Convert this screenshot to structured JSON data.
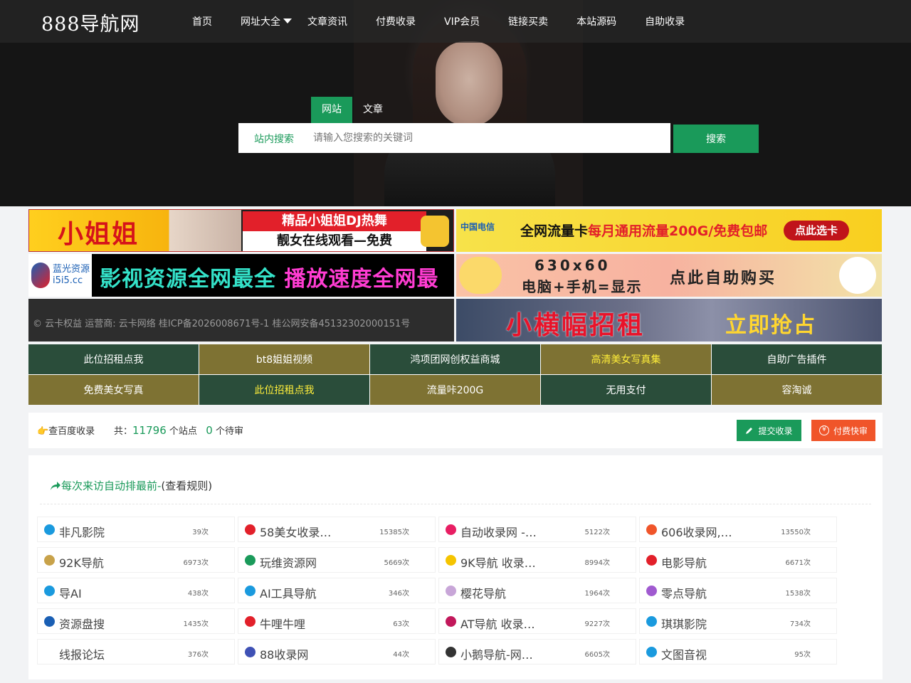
{
  "header": {
    "logo": "888导航网",
    "nav": [
      "首页",
      "网址大全",
      "文章资讯",
      "付费收录",
      "VIP会员",
      "链接买卖",
      "本站源码",
      "自助收录"
    ]
  },
  "search": {
    "tabs": [
      "网站",
      "文章"
    ],
    "label": "站内搜索",
    "placeholder": "请输入您搜索的关键词",
    "button": "搜索"
  },
  "banners": {
    "b1": {
      "big": "小姐姐",
      "line1": "精品小姐姐DJ热舞",
      "line2": "靓女在线观看—免费"
    },
    "b2": {
      "brand": "中国电信",
      "text_a": "全网流量卡",
      "text_b": "每月通用流量200G/免费包邮",
      "button": "点此选卡"
    },
    "b3": {
      "brand_top": "蓝光资源",
      "brand_bottom": "i5i5.cc",
      "text_a": "影视资源全网最全",
      "text_b": "播放速度全网最快"
    },
    "b4": {
      "size": "630x60",
      "line2": "电脑+手机=显示",
      "cta": "点此自助购买"
    },
    "b5": {
      "footer": "© 云卡权益 运营商: 云卡网络 桂ICP备2026008671号-1  桂公网安备45132302000151号"
    },
    "b6": {
      "text_a": "小横幅招租",
      "text_b": "立即抢占"
    }
  },
  "link_grid": [
    {
      "label": "此位招租点我",
      "style": "dg",
      "highlight": false
    },
    {
      "label": "bt8姐姐视频",
      "style": "ol",
      "highlight": false
    },
    {
      "label": "鸿项团网创权益商城",
      "style": "dg",
      "highlight": false
    },
    {
      "label": "高清美女写真集",
      "style": "ol",
      "highlight": true
    },
    {
      "label": "自助广告插件",
      "style": "dg",
      "highlight": false
    },
    {
      "label": "免费美女写真",
      "style": "ol",
      "highlight": false
    },
    {
      "label": "此位招租点我",
      "style": "dg",
      "highlight": true
    },
    {
      "label": "流量咔200G",
      "style": "ol",
      "highlight": false
    },
    {
      "label": "无用支付",
      "style": "dg",
      "highlight": false
    },
    {
      "label": "容淘诚",
      "style": "ol",
      "highlight": false
    }
  ],
  "stats": {
    "baidu": "👉查百度收录",
    "total_prefix": "共：",
    "total": "11796",
    "total_suffix": " 个站点",
    "pending": "0",
    "pending_suffix": " 个待审",
    "submit": "提交收录",
    "paid": "付费快审"
  },
  "panel": {
    "title": "每次来访自动排最前-",
    "rule": "(查看规则)",
    "sites": [
      {
        "name": "非凡影院",
        "count": "39次",
        "icon_color": "#1a9ade"
      },
      {
        "name": "58美女收录…",
        "count": "15385次",
        "icon_color": "#e2202a"
      },
      {
        "name": "自动收录网 -…",
        "count": "5122次",
        "icon_color": "#e81e63"
      },
      {
        "name": "606收录网,…",
        "count": "13550次",
        "icon_color": "#f0552a"
      },
      {
        "name": "92K导航",
        "count": "6973次",
        "icon_color": "#c8a24a"
      },
      {
        "name": "玩维资源网",
        "count": "5669次",
        "icon_color": "#1a9a5a"
      },
      {
        "name": "9K导航  收录…",
        "count": "8994次",
        "icon_color": "#f5c400"
      },
      {
        "name": "电影导航",
        "count": "6671次",
        "icon_color": "#e2202a"
      },
      {
        "name": "导AI",
        "count": "438次",
        "icon_color": "#1a9ade"
      },
      {
        "name": "AI工具导航",
        "count": "346次",
        "icon_color": "#1a9ade"
      },
      {
        "name": "樱花导航",
        "count": "1964次",
        "icon_color": "#c8a6d8"
      },
      {
        "name": "零点导航",
        "count": "1538次",
        "icon_color": "#a05ad0"
      },
      {
        "name": "资源盘搜",
        "count": "1435次",
        "icon_color": "#1a5fb4"
      },
      {
        "name": "牛哩牛哩",
        "count": "63次",
        "icon_color": "#e2202a"
      },
      {
        "name": "AT导航  收录…",
        "count": "9227次",
        "icon_color": "#c2185b"
      },
      {
        "name": "琪琪影院",
        "count": "734次",
        "icon_color": "#1a9ade"
      },
      {
        "name": "线报论坛",
        "count": "376次",
        "icon_color": "#ffffff"
      },
      {
        "name": "88收录网",
        "count": "44次",
        "icon_color": "#3f51b5"
      },
      {
        "name": "小鹅导航-网…",
        "count": "6605次",
        "icon_color": "#333333"
      },
      {
        "name": "文图音视",
        "count": "95次",
        "icon_color": "#1a9ade"
      }
    ]
  },
  "colors": {
    "accent": "#1a9a5a",
    "orange": "#f0552a",
    "dark_green": "#2a4d3a",
    "olive": "#7e7233"
  }
}
